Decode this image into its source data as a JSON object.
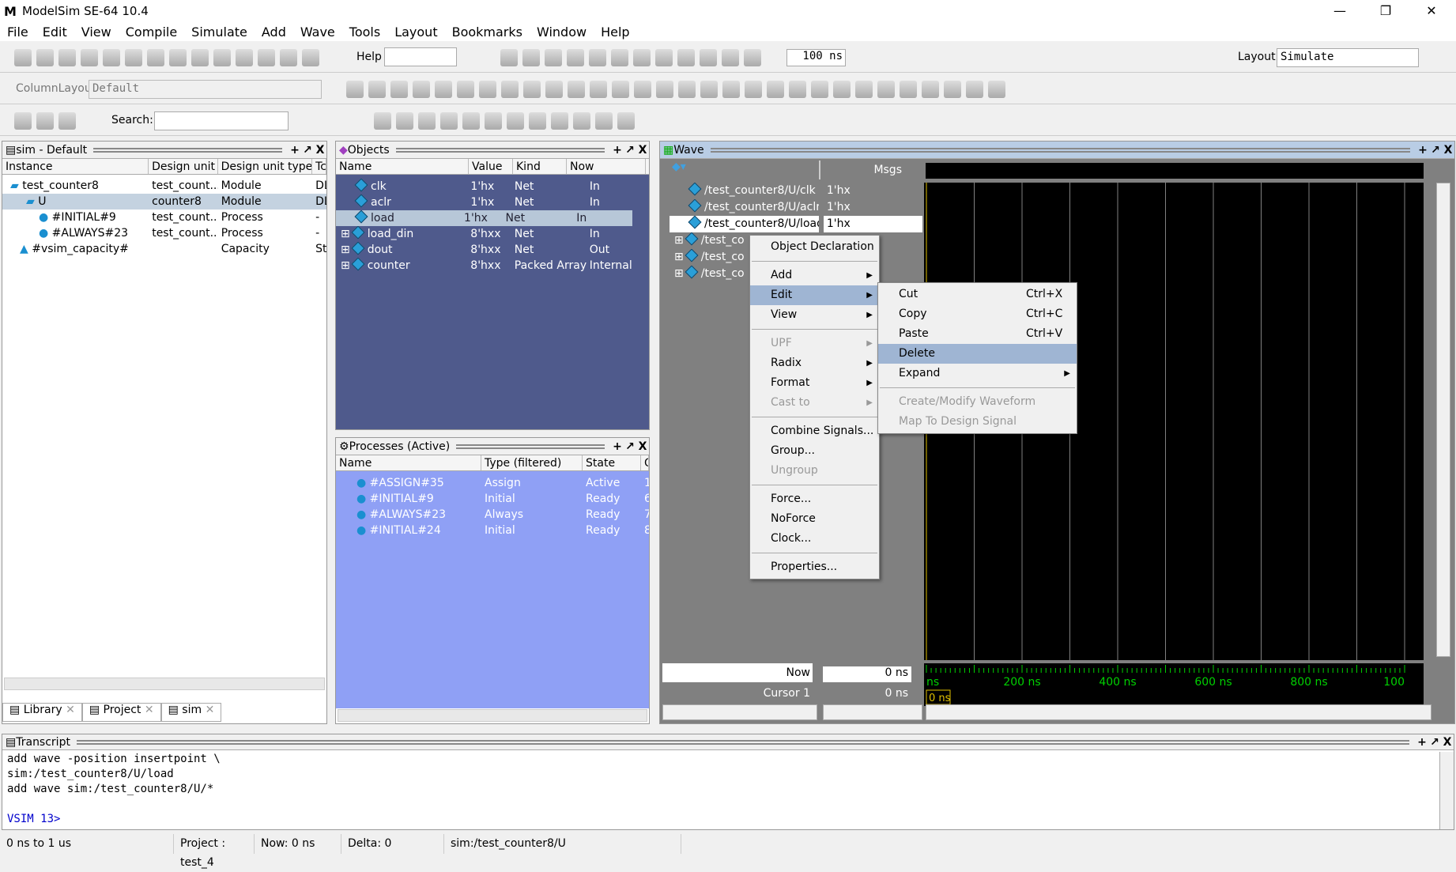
{
  "window": {
    "title": "ModelSim SE-64 10.4"
  },
  "menubar": [
    "File",
    "Edit",
    "View",
    "Compile",
    "Simulate",
    "Add",
    "Wave",
    "Tools",
    "Layout",
    "Bookmarks",
    "Window",
    "Help"
  ],
  "toolbar": {
    "help_label": "Help",
    "time_value": "100 ns",
    "layout_label": "Layout",
    "layout_value": "Simulate",
    "columnlayout_label": "ColumnLayout",
    "columnlayout_value": "Default",
    "search_label": "Search:"
  },
  "sim_panel": {
    "title": "sim - Default",
    "columns": [
      "Instance",
      "Design unit",
      "Design unit type",
      "Tc"
    ],
    "rows": [
      [
        "test_counter8",
        "test_count...",
        "Module",
        "DL"
      ],
      [
        "U",
        "counter8",
        "Module",
        "DL"
      ],
      [
        "#INITIAL#9",
        "test_count...",
        "Process",
        "-"
      ],
      [
        "#ALWAYS#23",
        "test_count...",
        "Process",
        "-"
      ],
      [
        "#vsim_capacity#",
        "",
        "Capacity",
        "St"
      ]
    ],
    "tabs": [
      "Library",
      "Project",
      "sim"
    ]
  },
  "objects_panel": {
    "title": "Objects",
    "columns": [
      "Name",
      "Value",
      "Kind",
      "Now"
    ],
    "rows": [
      [
        "clk",
        "1'hx",
        "Net",
        "In"
      ],
      [
        "aclr",
        "1'hx",
        "Net",
        "In"
      ],
      [
        "load",
        "1'hx",
        "Net",
        "In"
      ],
      [
        "load_din",
        "8'hxx",
        "Net",
        "In"
      ],
      [
        "dout",
        "8'hxx",
        "Net",
        "Out"
      ],
      [
        "counter",
        "8'hxx",
        "Packed Array",
        "Internal"
      ]
    ]
  },
  "processes_panel": {
    "title": "Processes (Active)",
    "columns": [
      "Name",
      "Type (filtered)",
      "State",
      "O"
    ],
    "rows": [
      [
        "#ASSIGN#35",
        "Assign",
        "Active",
        "1"
      ],
      [
        "#INITIAL#9",
        "Initial",
        "Ready",
        "6"
      ],
      [
        "#ALWAYS#23",
        "Always",
        "Ready",
        "7"
      ],
      [
        "#INITIAL#24",
        "Initial",
        "Ready",
        "8"
      ]
    ]
  },
  "wave_panel": {
    "title": "Wave",
    "msgs_label": "Msgs",
    "signals": [
      [
        "/test_counter8/U/clk",
        "1'hx"
      ],
      [
        "/test_counter8/U/aclr",
        "1'hx"
      ],
      [
        "/test_counter8/U/load",
        "1'hx"
      ],
      [
        "/test_co",
        ""
      ],
      [
        "/test_co",
        ""
      ],
      [
        "/test_co",
        ""
      ]
    ],
    "now_label": "Now",
    "now_value": "0 ns",
    "cursor_label": "Cursor 1",
    "cursor_value": "0 ns",
    "cursor_marker": "0 ns",
    "ticks": [
      "ns",
      "200 ns",
      "400 ns",
      "600 ns",
      "800 ns",
      "100"
    ]
  },
  "context_menu": [
    {
      "label": "Object Declaration"
    },
    {
      "sep": true
    },
    {
      "label": "Add",
      "sub": true
    },
    {
      "label": "Edit",
      "sub": true,
      "hl": true
    },
    {
      "label": "View",
      "sub": true
    },
    {
      "sep": true
    },
    {
      "label": "UPF",
      "sub": true,
      "dis": true
    },
    {
      "label": "Radix",
      "sub": true
    },
    {
      "label": "Format",
      "sub": true
    },
    {
      "label": "Cast to",
      "sub": true,
      "dis": true
    },
    {
      "sep": true
    },
    {
      "label": "Combine Signals..."
    },
    {
      "label": "Group..."
    },
    {
      "label": "Ungroup",
      "dis": true
    },
    {
      "sep": true
    },
    {
      "label": "Force..."
    },
    {
      "label": "NoForce"
    },
    {
      "label": "Clock..."
    },
    {
      "sep": true
    },
    {
      "label": "Properties..."
    }
  ],
  "edit_submenu": [
    {
      "label": "Cut",
      "sc": "Ctrl+X"
    },
    {
      "label": "Copy",
      "sc": "Ctrl+C"
    },
    {
      "label": "Paste",
      "sc": "Ctrl+V"
    },
    {
      "label": "Delete",
      "hl": true
    },
    {
      "label": "Expand",
      "sub": true
    },
    {
      "sep": true
    },
    {
      "label": "Create/Modify Waveform",
      "dis": true
    },
    {
      "label": "Map To Design Signal",
      "dis": true
    }
  ],
  "transcript": {
    "title": "Transcript",
    "lines": [
      "add wave -position insertpoint  \\",
      "sim:/test_counter8/U/load",
      "add wave sim:/test_counter8/U/*",
      "",
      "VSIM 13>"
    ]
  },
  "statusbar": [
    "0 ns to 1 us",
    "Project : test_4",
    "Now: 0 ns",
    "Delta: 0",
    "sim:/test_counter8/U"
  ],
  "colors": {
    "objects_bg": "#4f5a8c",
    "processes_bg": "#8fa0f5",
    "wave_bg": "#000000",
    "wave_grid": "#808080",
    "cursor": "#e0c000",
    "timeline": "#00d000",
    "selection": "#b7c7d8"
  }
}
